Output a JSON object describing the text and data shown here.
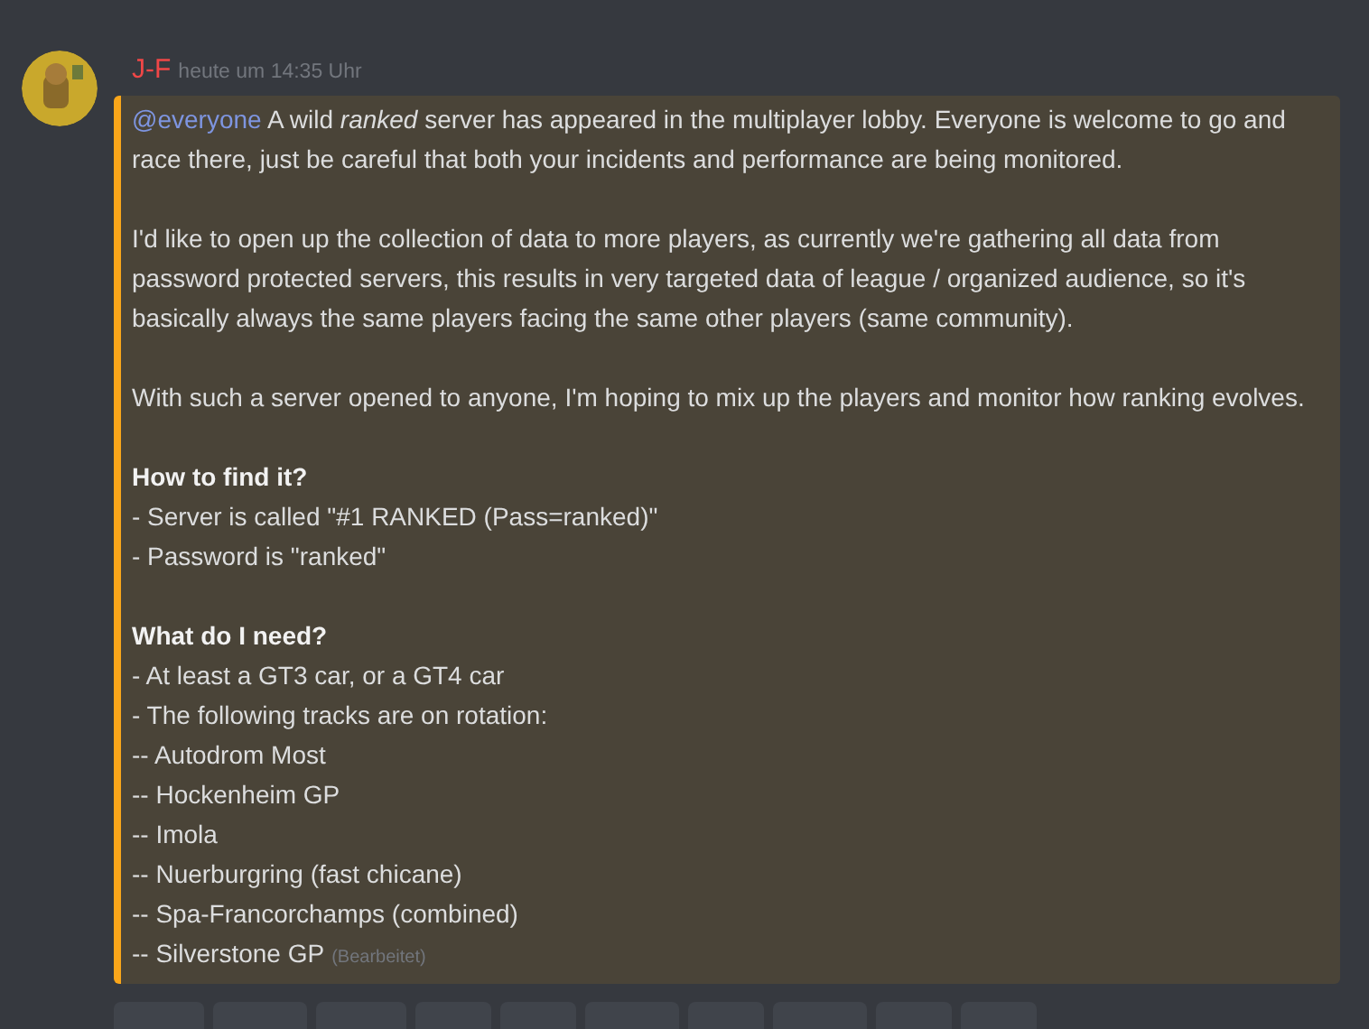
{
  "message": {
    "author": "J-F",
    "timestamp": "heute um 14:35 Uhr",
    "blocks": [
      {
        "kind": "paragraph",
        "mention": "@everyone",
        "text": "A wild *ranked* server has appeared in the multiplayer lobby. Everyone is welcome to go and race there, just be careful that both your incidents and performance are being monitored."
      },
      {
        "kind": "paragraph",
        "text": "I'd like to open up the collection of data to more players, as currently we're gathering all data from password protected servers, this results in very targeted data of league / organized audience, so it's basically always the same players facing the same other players (same community)."
      },
      {
        "kind": "paragraph",
        "text": "With such a server opened to anyone, I'm hoping to mix up the players and monitor how ranking evolves."
      },
      {
        "kind": "lines",
        "heading": "How to find it?",
        "lines": [
          "- Server is called \"#1 RANKED (Pass=ranked)\"",
          "- Password is \"ranked\""
        ]
      },
      {
        "kind": "lines",
        "heading": "What do I need?",
        "lines": [
          "- At least a GT3 car, or a GT4 car",
          "- The following tracks are on rotation:",
          "-- Autodrom Most",
          "-- Hockenheim GP",
          "-- Imola",
          "-- Nuerburgring (fast chicane)",
          "-- Spa-Francorchamps (combined)",
          "-- Silverstone GP"
        ]
      }
    ],
    "edited": "(Bearbeitet)"
  }
}
